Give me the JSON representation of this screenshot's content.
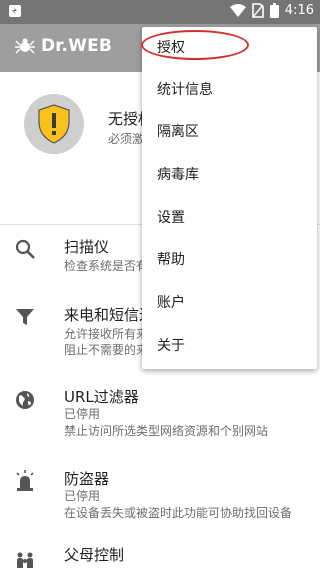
{
  "status_bar": {
    "time": "4:16",
    "icons": [
      "notification-icon",
      "wifi-icon",
      "no-sim-icon",
      "battery-icon"
    ]
  },
  "app": {
    "logo_text": "Dr.WEB"
  },
  "license_card": {
    "title": "无授权",
    "subtitle": "必须激"
  },
  "components": [
    {
      "title": "扫描仪",
      "subtitle": "检查系统是否有",
      "icon": "search-icon"
    },
    {
      "title": "来电和短信过",
      "subtitle_lines": [
        "允许接收所有来",
        "阻止不需要的来"
      ],
      "icon": "filter-icon"
    },
    {
      "title": "URL过滤器",
      "subtitle_lines": [
        "已停用",
        "禁止访问所选类型网络资源和个别网站"
      ],
      "icon": "globe-icon"
    },
    {
      "title": "防盗器",
      "subtitle_lines": [
        "已停用",
        "在设备丢失或被盗时此功能可协助找回设备"
      ],
      "icon": "siren-icon"
    },
    {
      "title": "父母控制",
      "icon": "family-icon"
    }
  ],
  "overflow_menu": {
    "items": [
      "授权",
      "统计信息",
      "隔离区",
      "病毒库",
      "设置",
      "帮助",
      "账户",
      "关于"
    ]
  },
  "colors": {
    "appbar": "#9e9e9e",
    "statusbar": "#757575",
    "shield": "#f9c21b",
    "highlight": "#d32f2f"
  }
}
